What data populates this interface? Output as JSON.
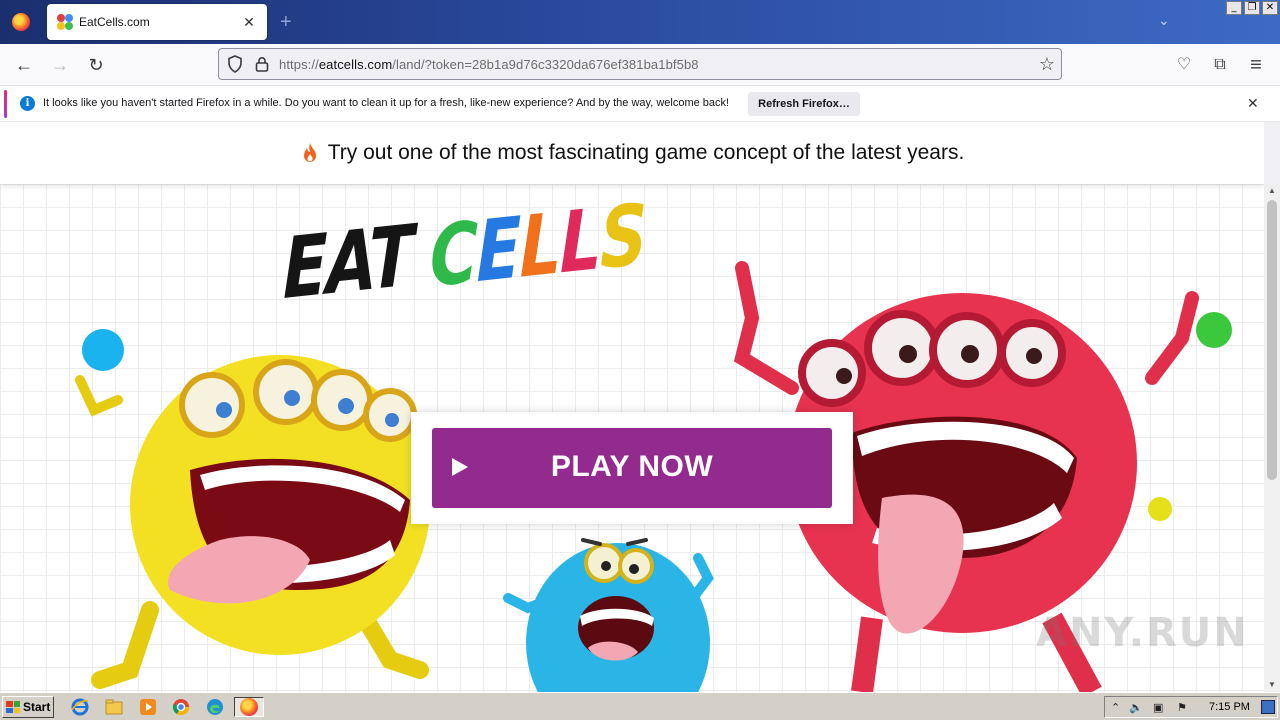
{
  "browser": {
    "tab": {
      "title": "EatCells.com",
      "close": "✕"
    },
    "new_tab": "+",
    "tab_list": "⌄",
    "window_controls": {
      "minimize": "_",
      "restore": "❐",
      "close": "✕"
    },
    "nav": {
      "back": "←",
      "forward": "→",
      "reload": "↻"
    },
    "url": {
      "prefix": "https://",
      "host": "eatcells.com",
      "path": "/land/?token=28b1a9d76c3320da676ef381ba1bf5b8"
    },
    "bookmark_star": "☆",
    "toolbar": {
      "pocket": "♡",
      "extensions": "⧉",
      "menu": "≡"
    }
  },
  "notification": {
    "icon": "i",
    "message": "It looks like you haven't started Firefox in a while. Do you want to clean it up for a fresh, like-new experience? And by the way, welcome back!",
    "button": "Refresh Firefox…",
    "close": "✕"
  },
  "page": {
    "headline": "Try out one of the most fascinating game concept of the latest years.",
    "logo": {
      "eat": "EAT",
      "cells_letters": [
        {
          "ch": "C",
          "color": "#2fb94a"
        },
        {
          "ch": "E",
          "color": "#2679e0"
        },
        {
          "ch": "L",
          "color": "#f0701c"
        },
        {
          "ch": "L",
          "color": "#e02a5b"
        },
        {
          "ch": "S",
          "color": "#e8c316"
        }
      ]
    },
    "play_button": "PLAY NOW",
    "accent_colors": {
      "play_button": "#932b8e",
      "dot_blue": "#1ab3f0",
      "dot_green": "#3cc83c",
      "dot_yellow": "#e6e01a"
    }
  },
  "scrollbar": {
    "up": "▲",
    "down": "▼"
  },
  "watermark": "ANY.RUN",
  "taskbar": {
    "start": "Start",
    "apps": [
      "internet-explorer-icon",
      "file-explorer-icon",
      "media-player-icon",
      "chrome-icon",
      "edge-icon",
      "firefox-icon"
    ],
    "tray": {
      "chevron": "⌃",
      "volume": "🔈",
      "network": "▣",
      "flag": "⚑"
    },
    "clock": "7:15 PM"
  }
}
